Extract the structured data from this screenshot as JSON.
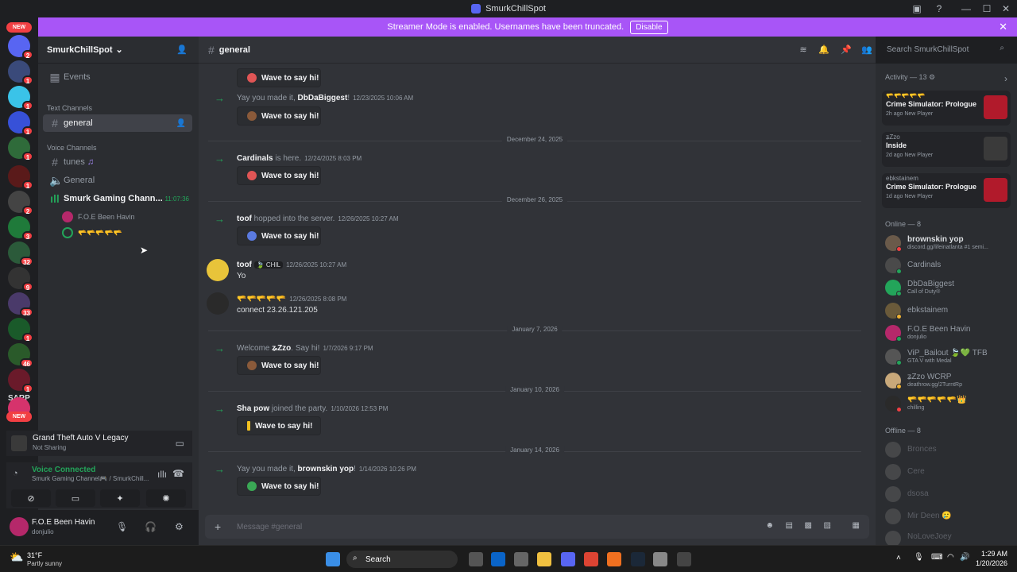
{
  "window": {
    "title": "SmurkChillSpot",
    "minimize": "—",
    "maximize": "☐",
    "close": "✕"
  },
  "banner": {
    "text": "Streamer Mode is enabled. Usernames have been truncated.",
    "disable_label": "Disable",
    "close": "✕",
    "color": "#a855f7"
  },
  "rail": {
    "new_label": "NEW",
    "sarp_label": "SARP",
    "badges": [
      "2",
      "1",
      "1",
      "1",
      "1",
      "1",
      "2",
      "3",
      "32",
      "9",
      "33",
      "1",
      "46",
      "1",
      "1"
    ]
  },
  "server": {
    "name": "SmurkChillSpot",
    "chevron": "⌄"
  },
  "sidebar": {
    "events_label": "Events",
    "text_category": "Text Channels",
    "voice_category": "Voice Channels",
    "channels": {
      "general": "general",
      "tunes": "tunes",
      "voice_general": "General",
      "gaming": "Smurk Gaming Chann...",
      "gaming_timer": "11:07:36"
    },
    "voice_users": [
      "F.O.E Been Havin",
      "🫳🫳🫳🫳🫳"
    ]
  },
  "game_panel": {
    "title": "Grand Theft Auto V Legacy",
    "status": "Not Sharing"
  },
  "voice_panel": {
    "status": "Voice Connected",
    "channel": "Smurk Gaming Channel🎮 / SmurkChill..."
  },
  "user_panel": {
    "name": "F.O.E Been Havin",
    "status": "donjulio"
  },
  "header": {
    "channel": "general",
    "search_placeholder": "Search SmurkChillSpot"
  },
  "messages": {
    "wave_label": "Wave to say hi!",
    "m1": {
      "pre": "Yay you made it, ",
      "user": "DbDaBiggest",
      "post": "!",
      "ts": "12/23/2025 10:06 AM"
    },
    "d1": "December 24, 2025",
    "m2": {
      "user": "Cardinals",
      "post": " is here.",
      "ts": "12/24/2025 8:03 PM"
    },
    "d2": "December 26, 2025",
    "m3": {
      "user": "toof",
      "post": " hopped into the server.",
      "ts": "12/26/2025 10:27 AM"
    },
    "m4": {
      "user": "toof",
      "tag": "🍃 CHIL",
      "ts": "12/26/2025 10:27 AM",
      "text": "Yo"
    },
    "m5": {
      "user": "🫳🫳🫳🫳🫳",
      "ts": "12/26/2025 8:08 PM",
      "text": "connect 23.26.121.205"
    },
    "d3": "January 7, 2026",
    "m6": {
      "pre": "Welcome ",
      "user": "ʑZzᴏ",
      "post": ". Say hi!",
      "ts": "1/7/2026 9:17 PM"
    },
    "d4": "January 10, 2026",
    "m7": {
      "user": "Sha pow",
      "post": " joined the party.",
      "ts": "1/10/2026 12:53 PM"
    },
    "d5": "January 14, 2026",
    "m8": {
      "pre": "Yay you made it, ",
      "user": "brownskin yop",
      "post": "!",
      "ts": "1/14/2026 10:26 PM"
    },
    "composer_placeholder": "Message #general"
  },
  "activity": {
    "header": "Activity — 13",
    "cards": [
      {
        "user": "🫳🫳🫳🫳🫳",
        "title": "Crime Simulator: Prologue",
        "sub": "2h ago  New Player"
      },
      {
        "user": "ʑZzᴏ",
        "title": "Inside",
        "sub": "2d ago  New Player"
      },
      {
        "user": "ebkstainem",
        "title": "Crime Simulator: Prologue",
        "sub": "1d ago  New Player"
      }
    ]
  },
  "members": {
    "online_header": "Online — 8",
    "online": [
      {
        "name": "brownskin yop",
        "sub": "discord.gg/lifeinatlanta #1 semi..."
      },
      {
        "name": "Cardinals",
        "sub": ""
      },
      {
        "name": "DbDaBiggest",
        "sub": "Call of Duty®"
      },
      {
        "name": "ebkstainem",
        "sub": ""
      },
      {
        "name": "F.O.E Been Havin",
        "sub": "donjulio"
      },
      {
        "name": "ViP_Bailout 🍃💚 TFB",
        "sub": "GTA V with Medal"
      },
      {
        "name": "ʑZzᴏ WCRP",
        "sub": "deathrow.gg/2TurntRp"
      },
      {
        "name": "🫳🫳🫳🫳🫳👑",
        "sub": "chilling"
      }
    ],
    "offline_header": "Offline — 8",
    "offline": [
      "Bronces",
      "Cere",
      "dsosa",
      "Mir Deen 🥲",
      "NoLoveJoey"
    ]
  },
  "taskbar": {
    "weather_temp": "31°F",
    "weather_desc": "Partly sunny",
    "search_label": "Search",
    "time": "1:29 AM",
    "date": "1/20/2026"
  },
  "colors": {
    "accent": "#5865f2",
    "online": "#23a55a",
    "badge": "#f23f43"
  }
}
